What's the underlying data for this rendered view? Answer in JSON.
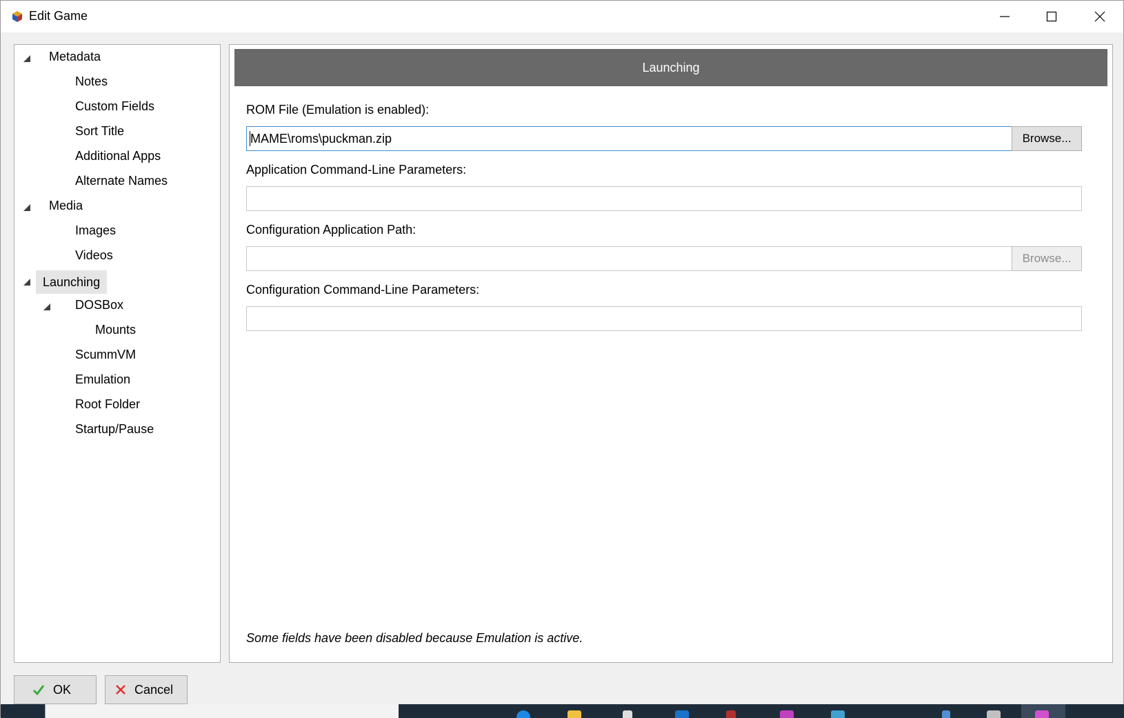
{
  "window": {
    "title": "Edit Game"
  },
  "tree": {
    "items": [
      {
        "label": "Metadata",
        "level": 0,
        "expandable": true
      },
      {
        "label": "Notes",
        "level": 1
      },
      {
        "label": "Custom Fields",
        "level": 1
      },
      {
        "label": "Sort Title",
        "level": 1
      },
      {
        "label": "Additional Apps",
        "level": 1
      },
      {
        "label": "Alternate Names",
        "level": 1
      },
      {
        "label": "Media",
        "level": 0,
        "expandable": true
      },
      {
        "label": "Images",
        "level": 1
      },
      {
        "label": "Videos",
        "level": 1
      },
      {
        "label": "Launching",
        "level": 0,
        "expandable": true,
        "selected": true
      },
      {
        "label": "DOSBox",
        "level": 1,
        "expandable": true
      },
      {
        "label": "Mounts",
        "level": 2
      },
      {
        "label": "ScummVM",
        "level": 1
      },
      {
        "label": "Emulation",
        "level": 1
      },
      {
        "label": "Root Folder",
        "level": 1
      },
      {
        "label": "Startup/Pause",
        "level": 1
      }
    ]
  },
  "content": {
    "header": "Launching",
    "rom_label": "ROM File (Emulation is enabled):",
    "rom_value": "MAME\\roms\\puckman.zip",
    "browse_label": "Browse...",
    "app_params_label": "Application Command-Line Parameters:",
    "app_params_value": "",
    "config_path_label": "Configuration Application Path:",
    "config_path_value": "",
    "config_browse_label": "Browse...",
    "config_params_label": "Configuration Command-Line Parameters:",
    "config_params_value": "",
    "note": "Some fields have been disabled because Emulation is active."
  },
  "buttons": {
    "ok": "OK",
    "cancel": "Cancel"
  },
  "colors": {
    "header_bg": "#696969",
    "focus_border": "#3c8fd6",
    "ok_check": "#3caa3c",
    "cancel_x": "#e03030"
  }
}
